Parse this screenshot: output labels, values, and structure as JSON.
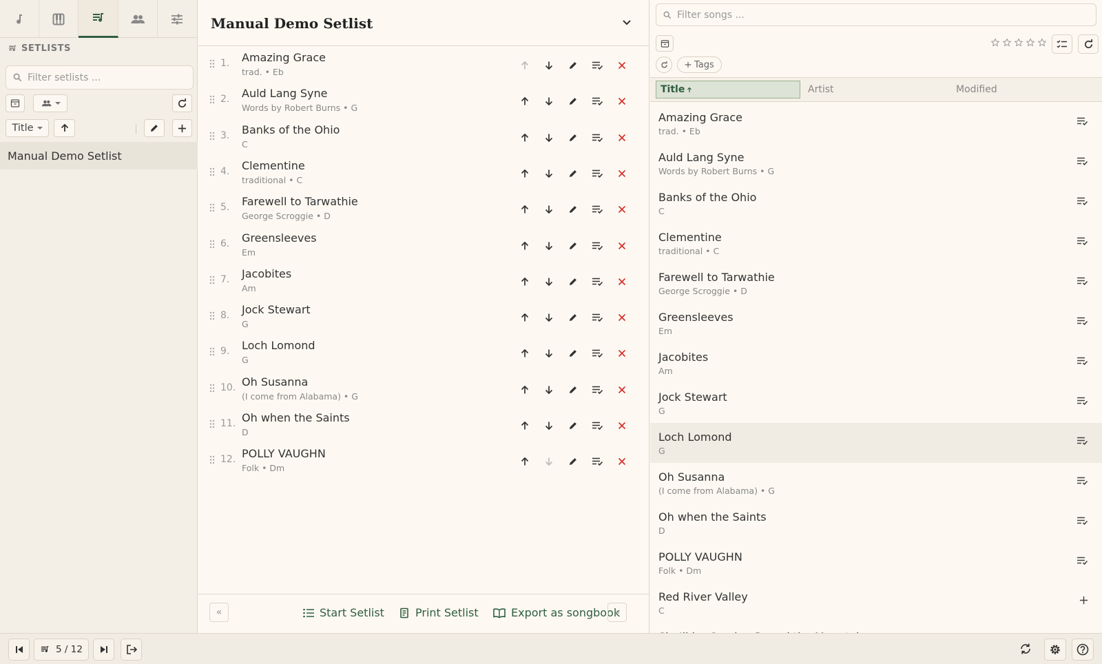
{
  "nav_tabs": [
    {
      "icon": "music-note-icon"
    },
    {
      "icon": "piano-icon"
    },
    {
      "icon": "setlist-icon",
      "active": true
    },
    {
      "icon": "people-icon"
    },
    {
      "icon": "sliders-icon"
    }
  ],
  "setlists": {
    "header": "SETLISTS",
    "filter_placeholder": "Filter setlists ...",
    "sort_label": "Title",
    "items": [
      "Manual Demo Setlist"
    ]
  },
  "setlist": {
    "title": "Manual Demo Setlist",
    "songs": [
      {
        "num": "1.",
        "title": "Amazing Grace",
        "sub": "trad. • Eb"
      },
      {
        "num": "2.",
        "title": "Auld Lang Syne",
        "sub": "Words by Robert Burns • G"
      },
      {
        "num": "3.",
        "title": "Banks of the Ohio",
        "sub": "C"
      },
      {
        "num": "4.",
        "title": "Clementine",
        "sub": "traditional • C"
      },
      {
        "num": "5.",
        "title": "Farewell to Tarwathie",
        "sub": "George Scroggie • D"
      },
      {
        "num": "6.",
        "title": "Greensleeves",
        "sub": "Em"
      },
      {
        "num": "7.",
        "title": "Jacobites",
        "sub": "Am"
      },
      {
        "num": "8.",
        "title": "Jock Stewart",
        "sub": "G"
      },
      {
        "num": "9.",
        "title": "Loch Lomond",
        "sub": "G"
      },
      {
        "num": "10.",
        "title": "Oh Susanna",
        "sub": "(I come from Alabama) • G"
      },
      {
        "num": "11.",
        "title": "Oh when the Saints",
        "sub": "D"
      },
      {
        "num": "12.",
        "title": "POLLY VAUGHN",
        "sub": "Folk • Dm"
      }
    ],
    "footer": {
      "prev": "«",
      "next": "»",
      "start": "Start Setlist",
      "print": "Print Setlist",
      "export": "Export as songbook"
    }
  },
  "library": {
    "filter_placeholder": "Filter songs ...",
    "tags_label": "Tags",
    "columns": {
      "title": "Title",
      "artist": "Artist",
      "modified": "Modified"
    },
    "songs": [
      {
        "title": "Amazing Grace",
        "sub": "trad. • Eb",
        "action": "in-setlist-icon"
      },
      {
        "title": "Auld Lang Syne",
        "sub": "Words by Robert Burns • G",
        "action": "in-setlist-icon"
      },
      {
        "title": "Banks of the Ohio",
        "sub": "C",
        "action": "in-setlist-icon"
      },
      {
        "title": "Clementine",
        "sub": "traditional • C",
        "action": "in-setlist-icon"
      },
      {
        "title": "Farewell to Tarwathie",
        "sub": "George Scroggie • D",
        "action": "in-setlist-icon"
      },
      {
        "title": "Greensleeves",
        "sub": "Em",
        "action": "in-setlist-icon"
      },
      {
        "title": "Jacobites",
        "sub": "Am",
        "action": "in-setlist-icon"
      },
      {
        "title": "Jock Stewart",
        "sub": "G",
        "action": "in-setlist-icon"
      },
      {
        "title": "Loch Lomond",
        "sub": "G",
        "action": "in-setlist-icon",
        "highlight": true
      },
      {
        "title": "Oh Susanna",
        "sub": "(I come from Alabama) • G",
        "action": "in-setlist-icon"
      },
      {
        "title": "Oh when the Saints",
        "sub": "D",
        "action": "in-setlist-icon"
      },
      {
        "title": "POLLY VAUGHN",
        "sub": "Folk • Dm",
        "action": "in-setlist-icon"
      },
      {
        "title": "Red River Valley",
        "sub": "C",
        "action": "add-icon"
      },
      {
        "title": "She'll be Coming Round the Mountain",
        "sub": "",
        "action": "add-icon"
      }
    ]
  },
  "bottom_bar": {
    "position": "5 / 12"
  },
  "colors": {
    "accent": "#2f5d3f",
    "remove": "#d9302c",
    "background": "#fcf7ef"
  }
}
